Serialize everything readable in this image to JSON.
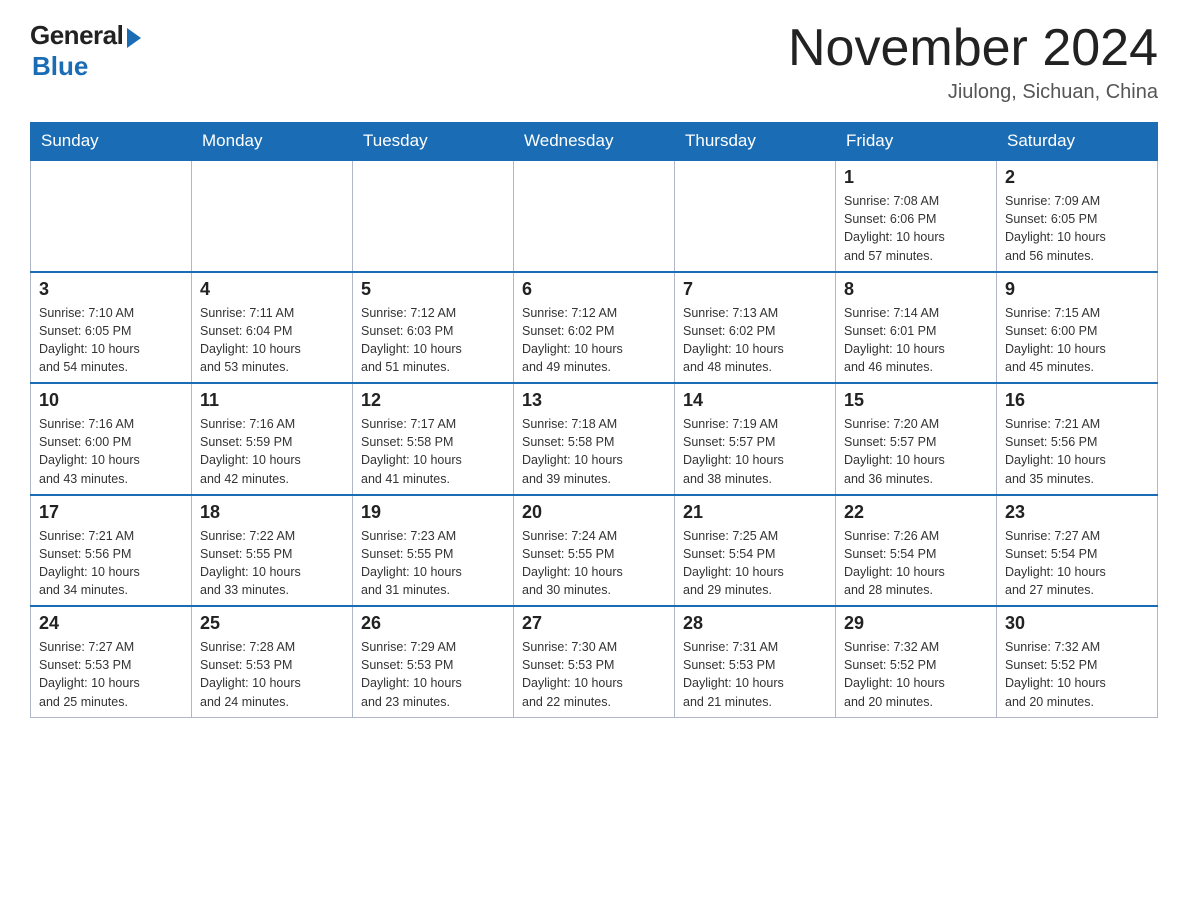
{
  "logo": {
    "general": "General",
    "blue": "Blue"
  },
  "title": {
    "month_year": "November 2024",
    "location": "Jiulong, Sichuan, China"
  },
  "days_of_week": [
    "Sunday",
    "Monday",
    "Tuesday",
    "Wednesday",
    "Thursday",
    "Friday",
    "Saturday"
  ],
  "weeks": [
    {
      "days": [
        {
          "num": "",
          "info": "",
          "empty": true
        },
        {
          "num": "",
          "info": "",
          "empty": true
        },
        {
          "num": "",
          "info": "",
          "empty": true
        },
        {
          "num": "",
          "info": "",
          "empty": true
        },
        {
          "num": "",
          "info": "",
          "empty": true
        },
        {
          "num": "1",
          "info": "Sunrise: 7:08 AM\nSunset: 6:06 PM\nDaylight: 10 hours\nand 57 minutes.",
          "empty": false
        },
        {
          "num": "2",
          "info": "Sunrise: 7:09 AM\nSunset: 6:05 PM\nDaylight: 10 hours\nand 56 minutes.",
          "empty": false
        }
      ]
    },
    {
      "days": [
        {
          "num": "3",
          "info": "Sunrise: 7:10 AM\nSunset: 6:05 PM\nDaylight: 10 hours\nand 54 minutes.",
          "empty": false
        },
        {
          "num": "4",
          "info": "Sunrise: 7:11 AM\nSunset: 6:04 PM\nDaylight: 10 hours\nand 53 minutes.",
          "empty": false
        },
        {
          "num": "5",
          "info": "Sunrise: 7:12 AM\nSunset: 6:03 PM\nDaylight: 10 hours\nand 51 minutes.",
          "empty": false
        },
        {
          "num": "6",
          "info": "Sunrise: 7:12 AM\nSunset: 6:02 PM\nDaylight: 10 hours\nand 49 minutes.",
          "empty": false
        },
        {
          "num": "7",
          "info": "Sunrise: 7:13 AM\nSunset: 6:02 PM\nDaylight: 10 hours\nand 48 minutes.",
          "empty": false
        },
        {
          "num": "8",
          "info": "Sunrise: 7:14 AM\nSunset: 6:01 PM\nDaylight: 10 hours\nand 46 minutes.",
          "empty": false
        },
        {
          "num": "9",
          "info": "Sunrise: 7:15 AM\nSunset: 6:00 PM\nDaylight: 10 hours\nand 45 minutes.",
          "empty": false
        }
      ]
    },
    {
      "days": [
        {
          "num": "10",
          "info": "Sunrise: 7:16 AM\nSunset: 6:00 PM\nDaylight: 10 hours\nand 43 minutes.",
          "empty": false
        },
        {
          "num": "11",
          "info": "Sunrise: 7:16 AM\nSunset: 5:59 PM\nDaylight: 10 hours\nand 42 minutes.",
          "empty": false
        },
        {
          "num": "12",
          "info": "Sunrise: 7:17 AM\nSunset: 5:58 PM\nDaylight: 10 hours\nand 41 minutes.",
          "empty": false
        },
        {
          "num": "13",
          "info": "Sunrise: 7:18 AM\nSunset: 5:58 PM\nDaylight: 10 hours\nand 39 minutes.",
          "empty": false
        },
        {
          "num": "14",
          "info": "Sunrise: 7:19 AM\nSunset: 5:57 PM\nDaylight: 10 hours\nand 38 minutes.",
          "empty": false
        },
        {
          "num": "15",
          "info": "Sunrise: 7:20 AM\nSunset: 5:57 PM\nDaylight: 10 hours\nand 36 minutes.",
          "empty": false
        },
        {
          "num": "16",
          "info": "Sunrise: 7:21 AM\nSunset: 5:56 PM\nDaylight: 10 hours\nand 35 minutes.",
          "empty": false
        }
      ]
    },
    {
      "days": [
        {
          "num": "17",
          "info": "Sunrise: 7:21 AM\nSunset: 5:56 PM\nDaylight: 10 hours\nand 34 minutes.",
          "empty": false
        },
        {
          "num": "18",
          "info": "Sunrise: 7:22 AM\nSunset: 5:55 PM\nDaylight: 10 hours\nand 33 minutes.",
          "empty": false
        },
        {
          "num": "19",
          "info": "Sunrise: 7:23 AM\nSunset: 5:55 PM\nDaylight: 10 hours\nand 31 minutes.",
          "empty": false
        },
        {
          "num": "20",
          "info": "Sunrise: 7:24 AM\nSunset: 5:55 PM\nDaylight: 10 hours\nand 30 minutes.",
          "empty": false
        },
        {
          "num": "21",
          "info": "Sunrise: 7:25 AM\nSunset: 5:54 PM\nDaylight: 10 hours\nand 29 minutes.",
          "empty": false
        },
        {
          "num": "22",
          "info": "Sunrise: 7:26 AM\nSunset: 5:54 PM\nDaylight: 10 hours\nand 28 minutes.",
          "empty": false
        },
        {
          "num": "23",
          "info": "Sunrise: 7:27 AM\nSunset: 5:54 PM\nDaylight: 10 hours\nand 27 minutes.",
          "empty": false
        }
      ]
    },
    {
      "days": [
        {
          "num": "24",
          "info": "Sunrise: 7:27 AM\nSunset: 5:53 PM\nDaylight: 10 hours\nand 25 minutes.",
          "empty": false
        },
        {
          "num": "25",
          "info": "Sunrise: 7:28 AM\nSunset: 5:53 PM\nDaylight: 10 hours\nand 24 minutes.",
          "empty": false
        },
        {
          "num": "26",
          "info": "Sunrise: 7:29 AM\nSunset: 5:53 PM\nDaylight: 10 hours\nand 23 minutes.",
          "empty": false
        },
        {
          "num": "27",
          "info": "Sunrise: 7:30 AM\nSunset: 5:53 PM\nDaylight: 10 hours\nand 22 minutes.",
          "empty": false
        },
        {
          "num": "28",
          "info": "Sunrise: 7:31 AM\nSunset: 5:53 PM\nDaylight: 10 hours\nand 21 minutes.",
          "empty": false
        },
        {
          "num": "29",
          "info": "Sunrise: 7:32 AM\nSunset: 5:52 PM\nDaylight: 10 hours\nand 20 minutes.",
          "empty": false
        },
        {
          "num": "30",
          "info": "Sunrise: 7:32 AM\nSunset: 5:52 PM\nDaylight: 10 hours\nand 20 minutes.",
          "empty": false
        }
      ]
    }
  ]
}
